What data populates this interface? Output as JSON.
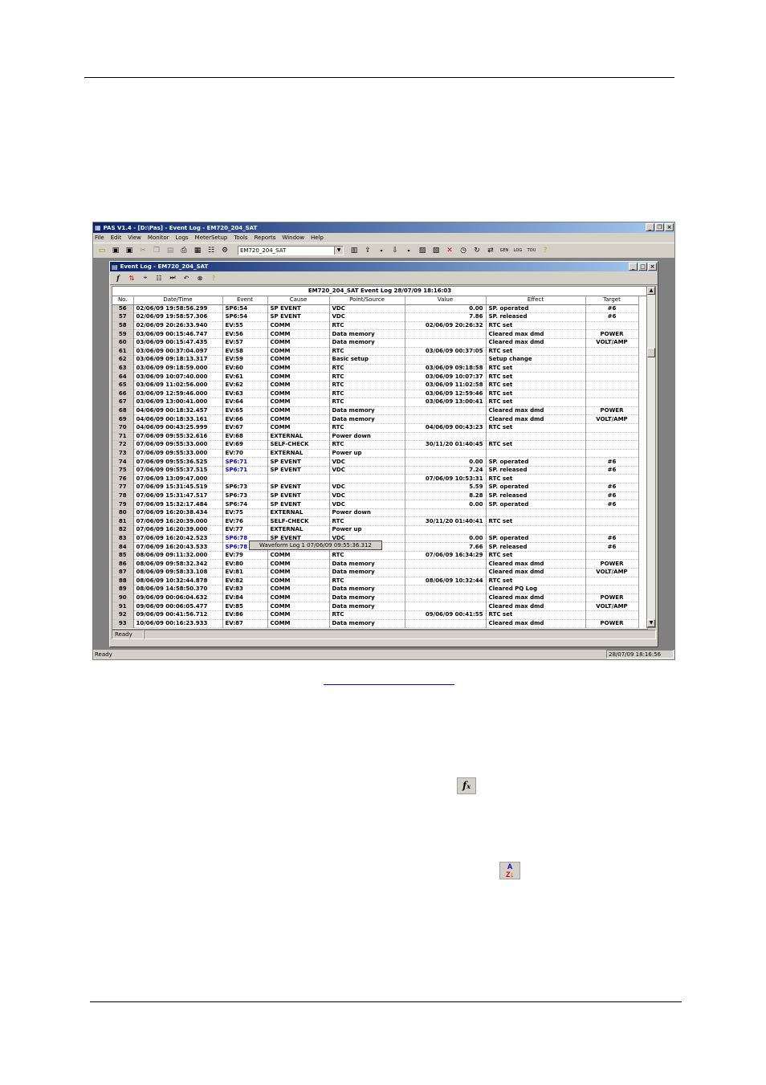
{
  "app": {
    "title": "PAS V1.4 - [D:\\Pas] - Event Log - EM720_204_SAT",
    "menu": [
      "File",
      "Edit",
      "View",
      "Monitor",
      "Logs",
      "MeterSetup",
      "Tools",
      "Reports",
      "Window",
      "Help"
    ],
    "site_combo": "EM720_204_SAT",
    "status_left": "Ready",
    "status_time": "28/07/09 18:16:56"
  },
  "child": {
    "title": "Event Log - EM720_204_SAT",
    "grid_title": "EM720_204_SAT  Event Log  28/07/09 18:16:03",
    "status": "Ready",
    "tooltip": "Waveform Log 1  07/06/09  09:55:36.312"
  },
  "columns": [
    "No.",
    "Date/Time",
    "Event",
    "Cause",
    "Point/Source",
    "Value",
    "Effect",
    "Target"
  ],
  "rows": [
    [
      "56",
      "02/06/09 19:58:56.299",
      "SP6:54",
      "SP EVENT",
      "VDC",
      "0.00",
      "SP. operated",
      "#6"
    ],
    [
      "57",
      "02/06/09 19:58:57.306",
      "SP6:54",
      "SP EVENT",
      "VDC",
      "7.86",
      "SP. released",
      "#6"
    ],
    [
      "58",
      "02/06/09 20:26:33.940",
      "EV:55",
      "COMM",
      "RTC",
      "02/06/09 20:26:32",
      "RTC set",
      ""
    ],
    [
      "59",
      "03/06/09 00:15:46.747",
      "EV:56",
      "COMM",
      "Data memory",
      "",
      "Cleared max dmd",
      "POWER"
    ],
    [
      "60",
      "03/06/09 00:15:47.435",
      "EV:57",
      "COMM",
      "Data memory",
      "",
      "Cleared max dmd",
      "VOLT/AMP"
    ],
    [
      "61",
      "03/06/09 00:37:04.097",
      "EV:58",
      "COMM",
      "RTC",
      "03/06/09 00:37:05",
      "RTC set",
      ""
    ],
    [
      "62",
      "03/06/09 09:18:13.317",
      "EV:59",
      "COMM",
      "Basic setup",
      "",
      "Setup change",
      ""
    ],
    [
      "63",
      "03/06/09 09:18:59.000",
      "EV:60",
      "COMM",
      "RTC",
      "03/06/09 09:18:58",
      "RTC set",
      ""
    ],
    [
      "64",
      "03/06/09 10:07:40.000",
      "EV:61",
      "COMM",
      "RTC",
      "03/06/09 10:07:37",
      "RTC set",
      ""
    ],
    [
      "65",
      "03/06/09 11:02:56.000",
      "EV:62",
      "COMM",
      "RTC",
      "03/06/09 11:02:58",
      "RTC set",
      ""
    ],
    [
      "66",
      "03/06/09 12:59:46.000",
      "EV:63",
      "COMM",
      "RTC",
      "03/06/09 12:59:46",
      "RTC set",
      ""
    ],
    [
      "67",
      "03/06/09 13:00:41.000",
      "EV:64",
      "COMM",
      "RTC",
      "03/06/09 13:00:41",
      "RTC set",
      ""
    ],
    [
      "68",
      "04/06/09 00:18:32.457",
      "EV:65",
      "COMM",
      "Data memory",
      "",
      "Cleared max dmd",
      "POWER"
    ],
    [
      "69",
      "04/06/09 00:18:33.161",
      "EV:66",
      "COMM",
      "Data memory",
      "",
      "Cleared max dmd",
      "VOLT/AMP"
    ],
    [
      "70",
      "04/06/09 00:43:25.999",
      "EV:67",
      "COMM",
      "RTC",
      "04/06/09 00:43:23",
      "RTC set",
      ""
    ],
    [
      "71",
      "07/06/09 09:55:32.616",
      "EV:68",
      "EXTERNAL",
      "Power down",
      "",
      "",
      ""
    ],
    [
      "72",
      "07/06/09 09:55:33.000",
      "EV:69",
      "SELF-CHECK",
      "RTC",
      "30/11/20 01:40:45",
      "RTC set",
      ""
    ],
    [
      "73",
      "07/06/09 09:55:33.000",
      "EV:70",
      "EXTERNAL",
      "Power up",
      "",
      "",
      ""
    ],
    [
      "74",
      "07/06/09 09:55:36.525",
      "SP6:71",
      "SP EVENT",
      "VDC",
      "0.00",
      "SP. operated",
      "#6"
    ],
    [
      "75",
      "07/06/09 09:55:37.515",
      "SP6:71",
      "SP EVENT",
      "VDC",
      "7.24",
      "SP. released",
      "#6"
    ],
    [
      "76",
      "07/06/09 13:09:47.000",
      "",
      "",
      "",
      "07/06/09 10:53:31",
      "RTC set",
      ""
    ],
    [
      "77",
      "07/06/09 15:31:45.519",
      "SP6:73",
      "SP EVENT",
      "VDC",
      "5.59",
      "SP. operated",
      "#6"
    ],
    [
      "78",
      "07/06/09 15:31:47.517",
      "SP6:73",
      "SP EVENT",
      "VDC",
      "8.28",
      "SP. released",
      "#6"
    ],
    [
      "79",
      "07/06/09 15:32:17.484",
      "SP6:74",
      "SP EVENT",
      "VDC",
      "0.00",
      "SP. operated",
      "#6"
    ],
    [
      "80",
      "07/06/09 16:20:38.434",
      "EV:75",
      "EXTERNAL",
      "Power down",
      "",
      "",
      ""
    ],
    [
      "81",
      "07/06/09 16:20:39.000",
      "EV:76",
      "SELF-CHECK",
      "RTC",
      "30/11/20 01:40:41",
      "RTC set",
      ""
    ],
    [
      "82",
      "07/06/09 16:20:39.000",
      "EV:77",
      "EXTERNAL",
      "Power up",
      "",
      "",
      ""
    ],
    [
      "83",
      "07/06/09 16:20:42.523",
      "SP6:78",
      "SP EVENT",
      "VDC",
      "0.00",
      "SP. operated",
      "#6"
    ],
    [
      "84",
      "07/06/09 16:20:43.533",
      "SP6:78",
      "SP EVENT",
      "VDC",
      "7.66",
      "SP. released",
      "#6"
    ],
    [
      "85",
      "08/06/09 09:11:32.000",
      "EV:79",
      "COMM",
      "RTC",
      "07/06/09 16:34:29",
      "RTC set",
      ""
    ],
    [
      "86",
      "08/06/09 09:58:32.342",
      "EV:80",
      "COMM",
      "Data memory",
      "",
      "Cleared max dmd",
      "POWER"
    ],
    [
      "87",
      "08/06/09 09:58:33.108",
      "EV:81",
      "COMM",
      "Data memory",
      "",
      "Cleared max dmd",
      "VOLT/AMP"
    ],
    [
      "88",
      "08/06/09 10:32:44.878",
      "EV:82",
      "COMM",
      "RTC",
      "08/06/09 10:32:44",
      "RTC set",
      ""
    ],
    [
      "89",
      "08/06/09 14:58:50.370",
      "EV:83",
      "COMM",
      "Data memory",
      "",
      "Cleared PQ Log",
      ""
    ],
    [
      "90",
      "09/06/09 00:06:04.632",
      "EV:84",
      "COMM",
      "Data memory",
      "",
      "Cleared max dmd",
      "POWER"
    ],
    [
      "91",
      "09/06/09 00:06:05.477",
      "EV:85",
      "COMM",
      "Data memory",
      "",
      "Cleared max dmd",
      "VOLT/AMP"
    ],
    [
      "92",
      "09/06/09 00:41:56.712",
      "EV:86",
      "COMM",
      "RTC",
      "09/06/09 00:41:55",
      "RTC set",
      ""
    ],
    [
      "93",
      "10/06/09 00:16:23.933",
      "EV:87",
      "COMM",
      "Data memory",
      "",
      "Cleared max dmd",
      "POWER"
    ]
  ],
  "linked_rows": [
    "74",
    "75",
    "83",
    "84"
  ],
  "colors": {
    "title_start": "#0a246a",
    "title_end": "#a6caf0",
    "link": "#0000cc"
  }
}
